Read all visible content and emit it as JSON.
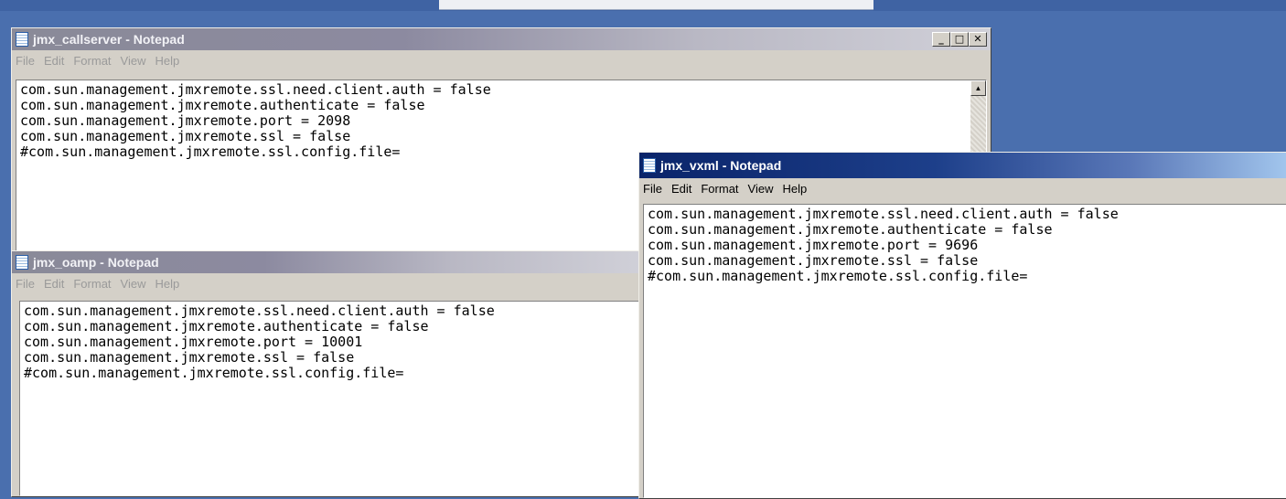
{
  "windows": {
    "callserver": {
      "title": "jmx_callserver - Notepad",
      "menu": [
        "File",
        "Edit",
        "Format",
        "View",
        "Help"
      ],
      "content": "com.sun.management.jmxremote.ssl.need.client.auth = false\ncom.sun.management.jmxremote.authenticate = false\ncom.sun.management.jmxremote.port = 2098\ncom.sun.management.jmxremote.ssl = false\n#com.sun.management.jmxremote.ssl.config.file=",
      "controls": {
        "minimize": "_",
        "maximize": "□",
        "close": "✕"
      }
    },
    "oamp": {
      "title": "jmx_oamp - Notepad",
      "menu": [
        "File",
        "Edit",
        "Format",
        "View",
        "Help"
      ],
      "content": "com.sun.management.jmxremote.ssl.need.client.auth = false\ncom.sun.management.jmxremote.authenticate = false\ncom.sun.management.jmxremote.port = 10001\ncom.sun.management.jmxremote.ssl = false\n#com.sun.management.jmxremote.ssl.config.file="
    },
    "vxml": {
      "title": "jmx_vxml - Notepad",
      "menu": [
        "File",
        "Edit",
        "Format",
        "View",
        "Help"
      ],
      "content": "com.sun.management.jmxremote.ssl.need.client.auth = false\ncom.sun.management.jmxremote.authenticate = false\ncom.sun.management.jmxremote.port = 9696\ncom.sun.management.jmxremote.ssl = false\n#com.sun.management.jmxremote.ssl.config.file="
    }
  },
  "icons": {
    "notepad": "notepad-icon",
    "scroll_up": "▲"
  },
  "colors": {
    "desktop": "#4a6fae",
    "active_title": "#0a246a",
    "inactive_title": "#8a8a98"
  }
}
